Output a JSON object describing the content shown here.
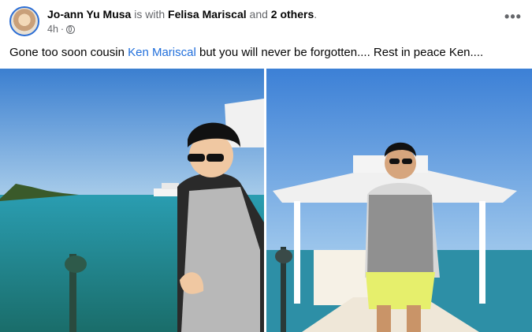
{
  "post": {
    "author": "Jo-ann Yu Musa",
    "is_with_text": "is with",
    "with_name": "Felisa Mariscal",
    "and_text": "and",
    "others": "2 others",
    "period": ".",
    "time": "4h",
    "more_icon": "more-options-icon",
    "audience_icon": "globe-icon",
    "caption_before": "Gone too soon cousin ",
    "caption_tag": "Ken Mariscal",
    "caption_after": " but you will never be forgotten.... Rest in peace Ken...."
  },
  "photos": [
    {
      "description_icon": "photo-1"
    },
    {
      "description_icon": "photo-2"
    }
  ],
  "colors": {
    "link": "#216fdb",
    "muted": "#65676b",
    "text": "#050505"
  }
}
